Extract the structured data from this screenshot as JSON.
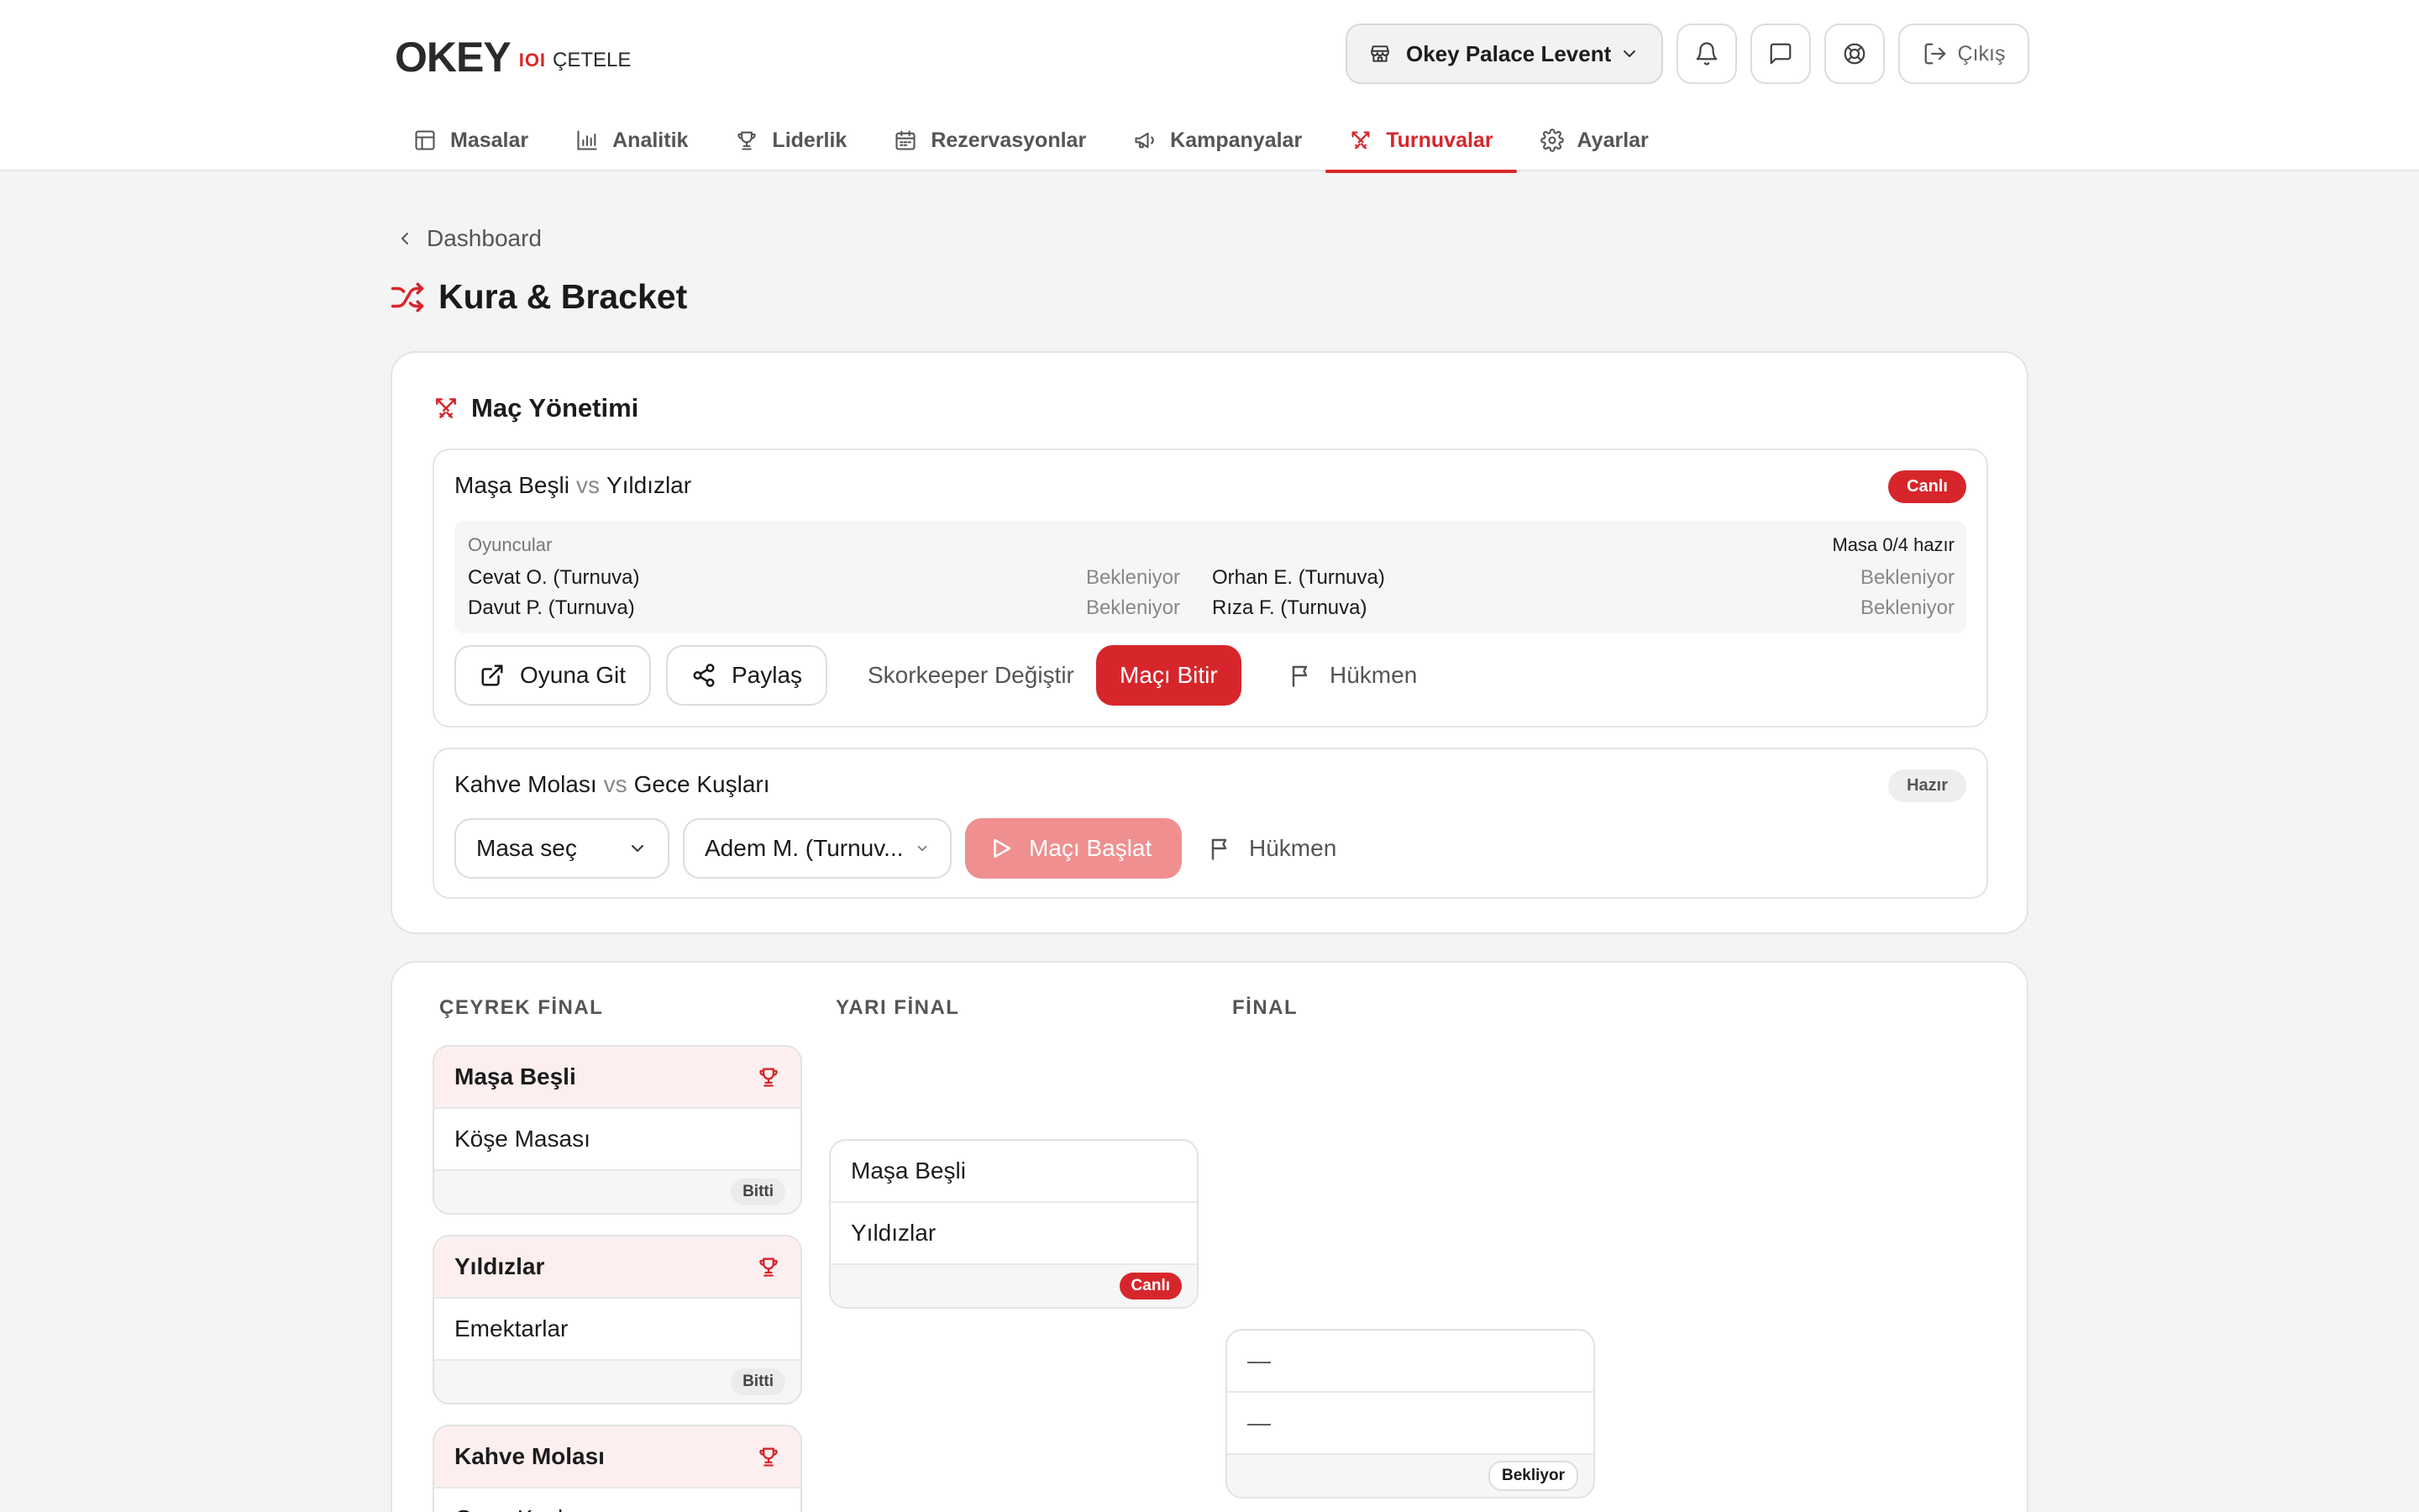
{
  "header": {
    "logo_main": "OKEY",
    "logo_tiles": "IOI",
    "logo_sub": "ÇETELE",
    "venue_name": "Okey Palace Levent",
    "logout_label": "Çıkış"
  },
  "nav": {
    "items": [
      {
        "label": "Masalar",
        "icon": "table-icon"
      },
      {
        "label": "Analitik",
        "icon": "bar-chart-icon"
      },
      {
        "label": "Liderlik",
        "icon": "trophy-icon"
      },
      {
        "label": "Rezervasyonlar",
        "icon": "calendar-icon"
      },
      {
        "label": "Kampanyalar",
        "icon": "megaphone-icon"
      },
      {
        "label": "Turnuvalar",
        "icon": "swords-icon",
        "active": true
      },
      {
        "label": "Ayarlar",
        "icon": "gear-icon"
      }
    ]
  },
  "breadcrumb": {
    "label": "Dashboard"
  },
  "page": {
    "title": "Kura & Bracket"
  },
  "management": {
    "title": "Maç Yönetimi",
    "match1": {
      "team_a": "Maşa Beşli",
      "vs": "vs",
      "team_b": "Yıldızlar",
      "status": "Canlı",
      "players_label": "Oyuncular",
      "table_ready": "Masa 0/4 hazır",
      "players": [
        {
          "name": "Cevat O. (Turnuva)",
          "status": "Bekleniyor"
        },
        {
          "name": "Orhan E. (Turnuva)",
          "status": "Bekleniyor"
        },
        {
          "name": "Davut P. (Turnuva)",
          "status": "Bekleniyor"
        },
        {
          "name": "Rıza F. (Turnuva)",
          "status": "Bekleniyor"
        }
      ],
      "go_to_game": "Oyuna Git",
      "share": "Paylaş",
      "change_scorekeeper": "Skorkeeper Değiştir",
      "end_match": "Maçı Bitir",
      "forfeit": "Hükmen"
    },
    "match2": {
      "team_a": "Kahve Molası",
      "vs": "vs",
      "team_b": "Gece Kuşları",
      "status": "Hazır",
      "table_select": "Masa seç",
      "player_select": "Adem M. (Turnuv...",
      "start_match": "Maçı Başlat",
      "forfeit": "Hükmen"
    }
  },
  "bracket": {
    "rounds": [
      "ÇEYREK FİNAL",
      "YARI FİNAL",
      "FİNAL"
    ],
    "quarter": [
      {
        "winner": "Maşa Beşli",
        "loser": "Köşe Masası",
        "status": "Bitti"
      },
      {
        "winner": "Yıldızlar",
        "loser": "Emektarlar",
        "status": "Bitti"
      },
      {
        "winner": "Kahve Molası",
        "loser": "Gece Kuşları"
      }
    ],
    "semi": [
      {
        "team_a": "Maşa Beşli",
        "team_b": "Yıldızlar",
        "status": "Canlı"
      }
    ],
    "final": [
      {
        "team_a": "—",
        "team_b": "—",
        "status": "Bekliyor"
      }
    ]
  },
  "colors": {
    "accent": "#d7262b",
    "accent_light": "#f08f90",
    "winner_bg": "#fdeff0"
  }
}
